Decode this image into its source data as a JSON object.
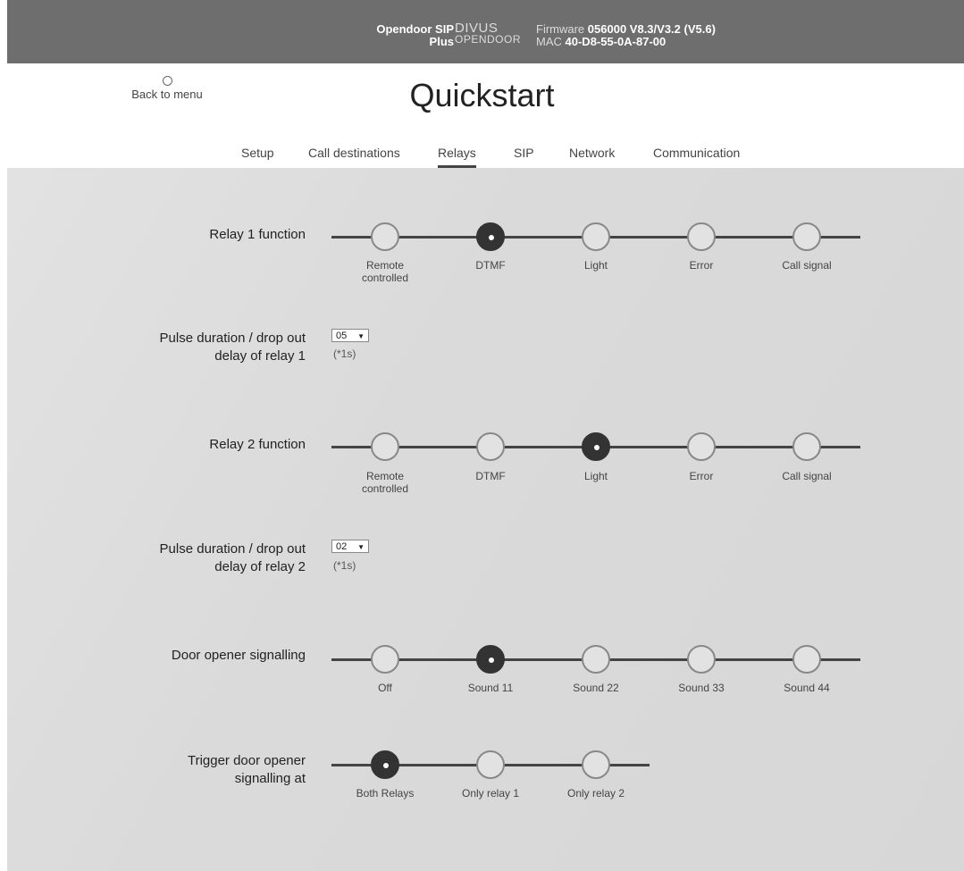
{
  "topbar": {
    "device_line1": "Opendoor SIP",
    "device_line2": "Plus",
    "brand_line1": "DIVUS",
    "brand_line2": "OPENDOOR",
    "fw_label": "Firmware",
    "fw_value": "056000 V8.3/V3.2 (V5.6)",
    "mac_label": "MAC",
    "mac_value": "40-D8-55-0A-87-00"
  },
  "header": {
    "back_label": "Back to menu",
    "title": "Quickstart",
    "tabs": [
      "Setup",
      "Call destinations",
      "Relays",
      "SIP",
      "Network",
      "Communication"
    ],
    "active_tab": "Relays"
  },
  "relay1": {
    "label": "Relay 1 function",
    "options": [
      "Remote controlled",
      "DTMF",
      "Light",
      "Error",
      "Call signal"
    ],
    "selected": "DTMF"
  },
  "pulse1": {
    "label_line1": "Pulse duration / drop out",
    "label_line2": "delay of relay 1",
    "value": "05",
    "unit": "(*1s)"
  },
  "relay2": {
    "label": "Relay 2 function",
    "options": [
      "Remote controlled",
      "DTMF",
      "Light",
      "Error",
      "Call signal"
    ],
    "selected": "Light"
  },
  "pulse2": {
    "label_line1": "Pulse duration / drop out",
    "label_line2": "delay of relay 2",
    "value": "02",
    "unit": "(*1s)"
  },
  "door_signal": {
    "label": "Door opener signalling",
    "options": [
      "Off",
      "Sound 11",
      "Sound 22",
      "Sound 33",
      "Sound 44"
    ],
    "selected": "Sound 11"
  },
  "trigger": {
    "label_line1": "Trigger door opener",
    "label_line2": "signalling at",
    "options": [
      "Both Relays",
      "Only relay 1",
      "Only relay 2"
    ],
    "selected": "Both Relays"
  },
  "colors": {
    "topbar": "#6e6e6e",
    "checked": "#333333",
    "unchecked_border": "#888888"
  }
}
